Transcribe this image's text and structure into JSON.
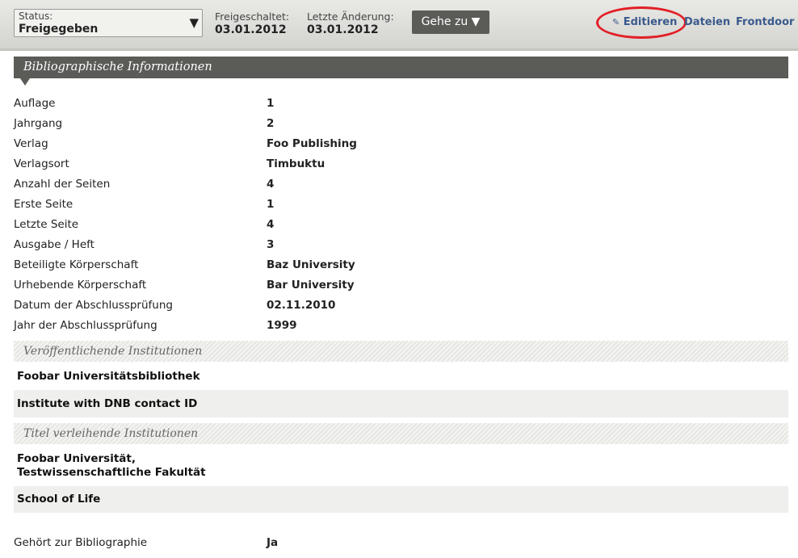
{
  "topbar": {
    "status_label": "Status:",
    "status_value": "Freigegeben",
    "released_label": "Freigeschaltet:",
    "released_value": "03.01.2012",
    "modified_label": "Letzte Änderung:",
    "modified_value": "03.01.2012",
    "goto_label": "Gehe zu ▼",
    "links": {
      "edit": "Editieren",
      "files": "Dateien",
      "frontdoor": "Frontdoor"
    },
    "highlight_color": "#e21f26"
  },
  "biblio": {
    "header": "Bibliographische Informationen",
    "rows": [
      {
        "key": "Auflage",
        "value": "1"
      },
      {
        "key": "Jahrgang",
        "value": "2"
      },
      {
        "key": "Verlag",
        "value": "Foo Publishing"
      },
      {
        "key": "Verlagsort",
        "value": "Timbuktu"
      },
      {
        "key": "Anzahl der Seiten",
        "value": "4"
      },
      {
        "key": "Erste Seite",
        "value": "1"
      },
      {
        "key": "Letzte Seite",
        "value": "4"
      },
      {
        "key": "Ausgabe / Heft",
        "value": "3"
      },
      {
        "key": "Beteiligte Körperschaft",
        "value": "Baz University"
      },
      {
        "key": "Urhebende Körperschaft",
        "value": "Bar University"
      },
      {
        "key": "Datum der Abschlussprüfung",
        "value": "02.11.2010"
      },
      {
        "key": "Jahr der Abschlussprüfung",
        "value": "1999"
      }
    ]
  },
  "publishing": {
    "header": "Veröffentlichende Institutionen",
    "items": [
      "Foobar Universitätsbibliothek",
      "Institute with DNB contact ID"
    ]
  },
  "granting": {
    "header": "Titel verleihende Institutionen",
    "items": [
      "Foobar Universität,",
      "Testwissenschaftliche Fakultät",
      "School of Life"
    ]
  },
  "bibliography": {
    "key": "Gehört zur Bibliographie",
    "value": "Ja"
  }
}
